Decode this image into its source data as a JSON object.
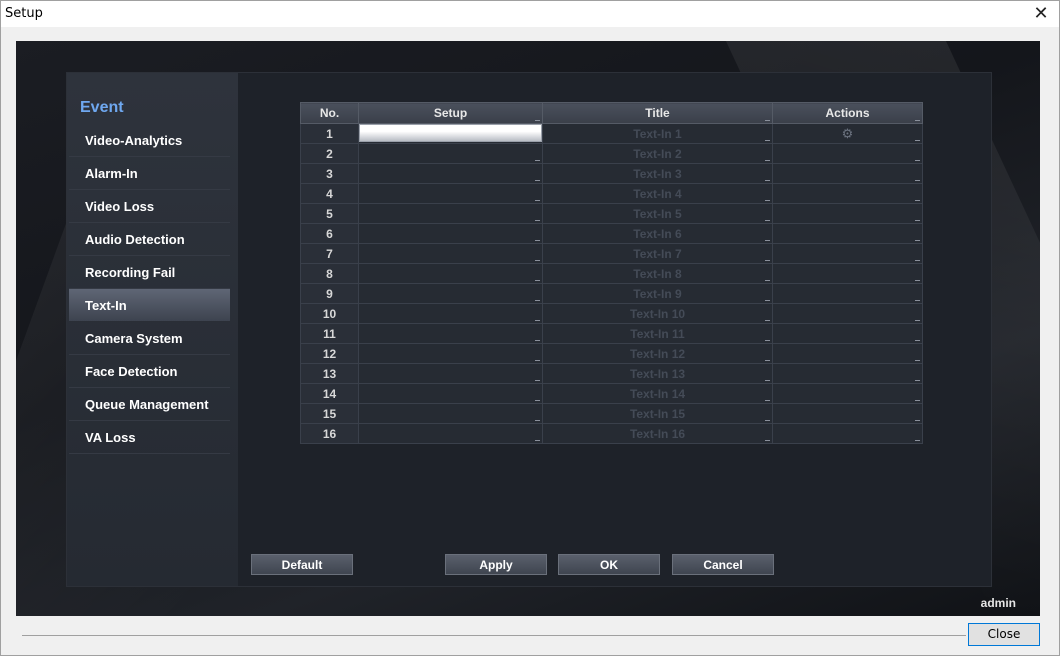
{
  "window": {
    "title": "Setup",
    "close_glyph": "✕"
  },
  "sidebar": {
    "section_title": "Event",
    "items": [
      {
        "label": "Video-Analytics",
        "active": false
      },
      {
        "label": "Alarm-In",
        "active": false
      },
      {
        "label": "Video Loss",
        "active": false
      },
      {
        "label": "Audio Detection",
        "active": false
      },
      {
        "label": "Recording Fail",
        "active": false
      },
      {
        "label": "Text-In",
        "active": true
      },
      {
        "label": "Camera System",
        "active": false
      },
      {
        "label": "Face Detection",
        "active": false
      },
      {
        "label": "Queue Management",
        "active": false
      },
      {
        "label": "VA Loss",
        "active": false
      }
    ]
  },
  "table": {
    "columns": [
      "No.",
      "Setup",
      "Title",
      "Actions"
    ],
    "rows": [
      {
        "no": "1",
        "title": "Text-In 1"
      },
      {
        "no": "2",
        "title": "Text-In 2"
      },
      {
        "no": "3",
        "title": "Text-In 3"
      },
      {
        "no": "4",
        "title": "Text-In 4"
      },
      {
        "no": "5",
        "title": "Text-In 5"
      },
      {
        "no": "6",
        "title": "Text-In 6"
      },
      {
        "no": "7",
        "title": "Text-In 7"
      },
      {
        "no": "8",
        "title": "Text-In 8"
      },
      {
        "no": "9",
        "title": "Text-In 9"
      },
      {
        "no": "10",
        "title": "Text-In 10"
      },
      {
        "no": "11",
        "title": "Text-In 11"
      },
      {
        "no": "12",
        "title": "Text-In 12"
      },
      {
        "no": "13",
        "title": "Text-In 13"
      },
      {
        "no": "14",
        "title": "Text-In 14"
      },
      {
        "no": "15",
        "title": "Text-In 15"
      },
      {
        "no": "16",
        "title": "Text-In 16"
      }
    ],
    "action_icon": "settings-icon",
    "action_glyph": "⚙"
  },
  "buttons": {
    "default": "Default",
    "apply": "Apply",
    "ok": "OK",
    "cancel": "Cancel"
  },
  "user": "admin",
  "dialog_close": "Close"
}
